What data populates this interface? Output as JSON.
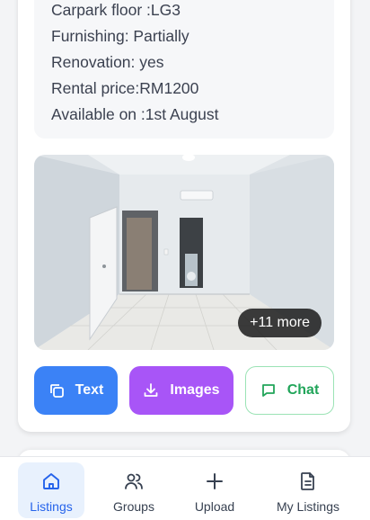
{
  "listing": {
    "details": [
      "Carpark floor :LG3",
      "Furnishing: Partially",
      "Renovation: yes",
      "Rental price:RM1200",
      "Available on :1st August"
    ],
    "photo_more_label": "+11 more",
    "actions": {
      "text_label": "Text",
      "images_label": "Images",
      "chat_label": "Chat"
    }
  },
  "nav": {
    "items": [
      {
        "label": "Listings",
        "icon": "home-icon",
        "active": true
      },
      {
        "label": "Groups",
        "icon": "users-icon",
        "active": false
      },
      {
        "label": "Upload",
        "icon": "plus-icon",
        "active": false
      },
      {
        "label": "My Listings",
        "icon": "document-icon",
        "active": false
      }
    ]
  },
  "colors": {
    "text_button": "#3b82f6",
    "images_button": "#a855f7",
    "chat_button_text": "#22a55a",
    "nav_active": "#2563eb"
  }
}
